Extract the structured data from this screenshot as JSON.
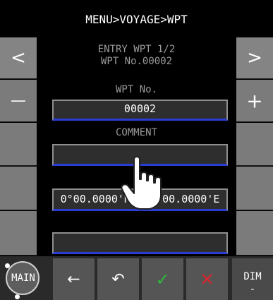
{
  "header": {
    "title": "MENU>VOYAGE>WPT"
  },
  "entry": {
    "line1": "ENTRY WPT 1/2",
    "line2": "WPT No.00002"
  },
  "wpt_no": {
    "label": "WPT No.",
    "value": "00002"
  },
  "comment": {
    "label": "COMMENT",
    "value": ""
  },
  "position": {
    "label": "P",
    "value": "0°00.0000'N 000°00.0000'E"
  },
  "extra_field": {
    "value": ""
  },
  "left_buttons": {
    "prev": "<",
    "minus": "—"
  },
  "right_buttons": {
    "next": ">",
    "plus": "+"
  },
  "bottom": {
    "main": "MAIN",
    "back": "←",
    "undo": "↶",
    "ok": "✓",
    "cancel": "✕",
    "dim_top": "DIM",
    "dim_bottom": "-"
  },
  "colors": {
    "accent_blue": "#2a3bd6",
    "ok_green": "#2dbb3a",
    "cancel_red": "#d8262e"
  }
}
